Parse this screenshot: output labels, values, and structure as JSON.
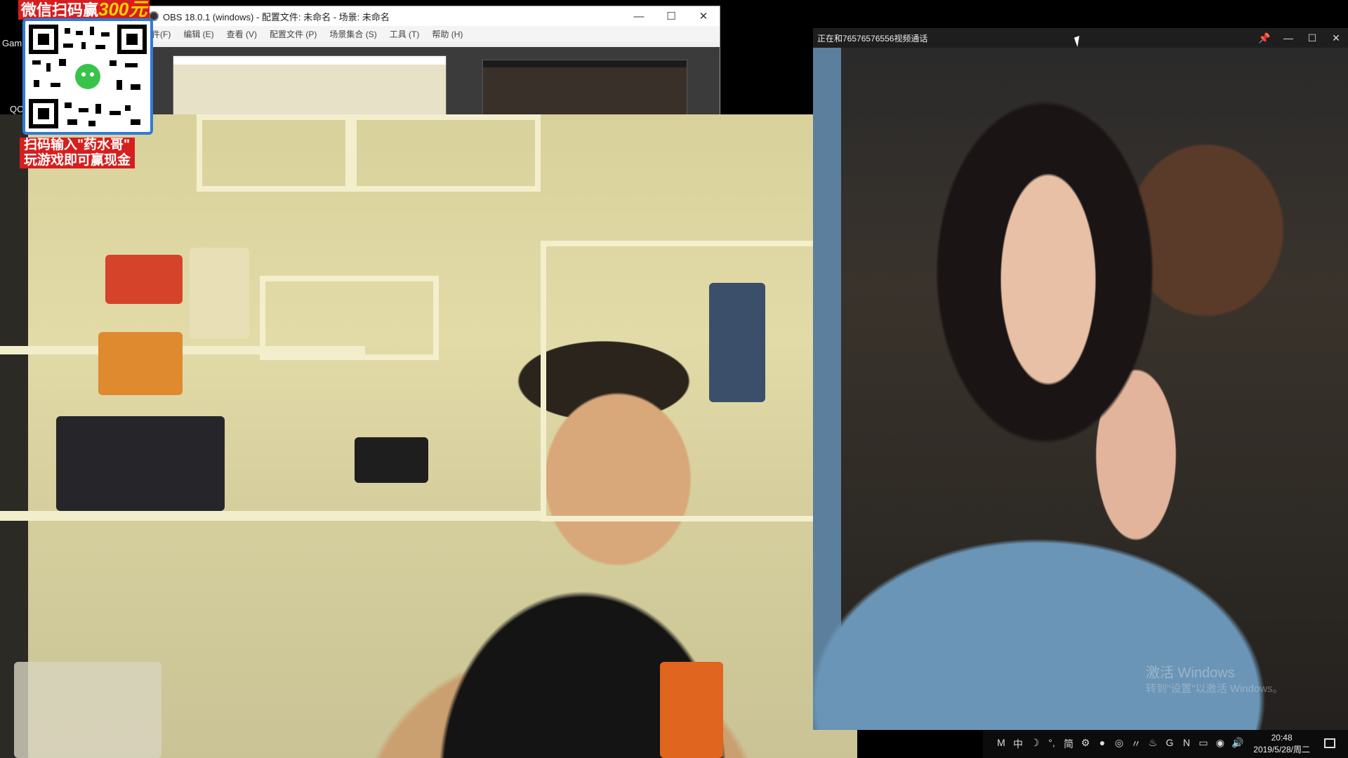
{
  "desktop": {
    "label_gam": "Gam",
    "label_qq": "QC"
  },
  "obs": {
    "title": "OBS 18.0.1 (windows) - 配置文件: 未命名 - 场景: 未命名",
    "menu": [
      "文件(F)",
      "编辑 (E)",
      "查看 (V)",
      "配置文件 (P)",
      "场景集合 (S)",
      "工具 (T)",
      "帮助 (H)"
    ],
    "btn_min": "—",
    "btn_max": "☐",
    "btn_close": "✕"
  },
  "promo": {
    "header_prefix": "微信扫码赢",
    "header_amount": "300元",
    "footer_line1": "扫码输入\"药水哥\"",
    "footer_line2": "玩游戏即可赢现金"
  },
  "call": {
    "title": "正在和76576576556视频通话",
    "ctl_pin": "📌",
    "ctl_min": "—",
    "ctl_max": "☐",
    "ctl_close": "✕",
    "watermark_line1": "激活 Windows",
    "watermark_line2": "转到\"设置\"以激活 Windows。"
  },
  "tray": {
    "icons": [
      "M",
      "中",
      "☽",
      "°,",
      "简",
      "⚙",
      "●",
      "◎",
      "〃",
      "♨",
      "G",
      "N",
      "▭",
      "◉",
      "🔊"
    ],
    "time": "20:48",
    "date": "2019/5/28/周二"
  }
}
